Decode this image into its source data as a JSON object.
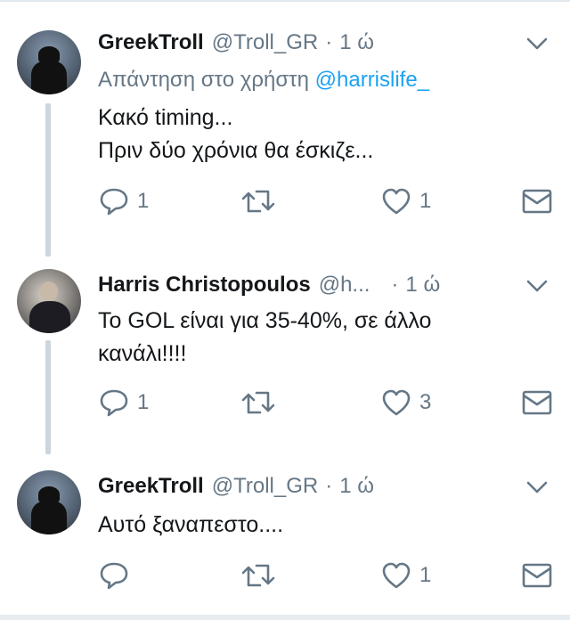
{
  "colors": {
    "accent": "#1da1f2",
    "text": "#14171a",
    "muted": "#657786",
    "thread_line": "#ccd6dd"
  },
  "tweets": [
    {
      "name": "GreekTroll",
      "handle": "@Troll_GR",
      "separator": "·",
      "time": "1 ώ",
      "reply_prefix": "Απάντηση στο χρήστη",
      "reply_mention": "@harrislife_",
      "text_lines": [
        "Κακό timing...",
        "Πριν δύο χρόνια θα έσκιζε..."
      ],
      "replies": "1",
      "retweets": "",
      "likes": "1"
    },
    {
      "name": "Harris Christopoulos",
      "handle": "@h...",
      "separator": "·",
      "time": "1 ώ",
      "text_lines": [
        "Το GOL είναι για 35-40%, σε άλλο",
        "κανάλι!!!!"
      ],
      "replies": "1",
      "retweets": "",
      "likes": "3"
    },
    {
      "name": "GreekTroll",
      "handle": "@Troll_GR",
      "separator": "·",
      "time": "1 ώ",
      "text_lines": [
        "Αυτό ξαναπεστο...."
      ],
      "replies": "",
      "retweets": "",
      "likes": "1"
    }
  ],
  "icons": [
    "reply-icon",
    "retweet-icon",
    "like-icon",
    "direct-message-icon",
    "chevron-down-icon"
  ]
}
